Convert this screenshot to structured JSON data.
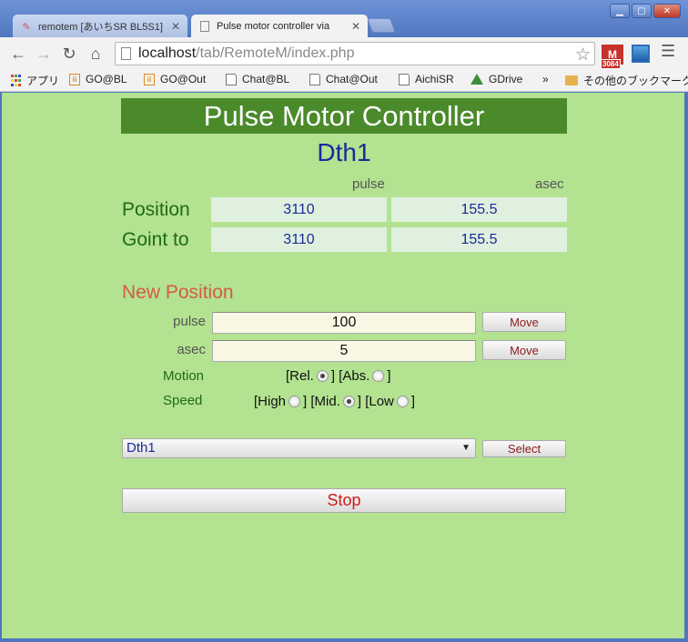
{
  "browser": {
    "tabs": [
      {
        "title": "remotem [あいちSR BL5S1]",
        "active": false
      },
      {
        "title": "Pulse motor controller via",
        "active": true
      }
    ],
    "url_host": "localhost",
    "url_path": "/tab/RemoteM/index.php",
    "gmail_count": "3084",
    "bookmarks": [
      "アプリ",
      "GO@BL",
      "GO@Out",
      "Chat@BL",
      "Chat@Out",
      "AichiSR",
      "GDrive"
    ],
    "more_bookmarks": "»",
    "other_bookmarks": "その他のブックマーク"
  },
  "page": {
    "title": "Pulse Motor Controller",
    "device": "Dth1",
    "col_pulse": "pulse",
    "col_asec": "asec",
    "position_label": "Position",
    "position_pulse": "3110",
    "position_asec": "155.5",
    "goingto_label": "Goint to",
    "goingto_pulse": "3110",
    "goingto_asec": "155.5",
    "new_position_label": "New Position",
    "pulse_label": "pulse",
    "pulse_value": "100",
    "asec_label": "asec",
    "asec_value": "5",
    "move_label": "Move",
    "motion_label": "Motion",
    "motion_rel": "[Rel.",
    "motion_abs": "] [Abs.",
    "motion_close": "]",
    "motion_selected": "Rel.",
    "speed_label": "Speed",
    "speed_high": "[High",
    "speed_mid": "] [Mid.",
    "speed_low": "] [Low",
    "speed_close": "]",
    "speed_selected": "Mid.",
    "device_select_value": "Dth1",
    "select_label": "Select",
    "stop_label": "Stop"
  }
}
